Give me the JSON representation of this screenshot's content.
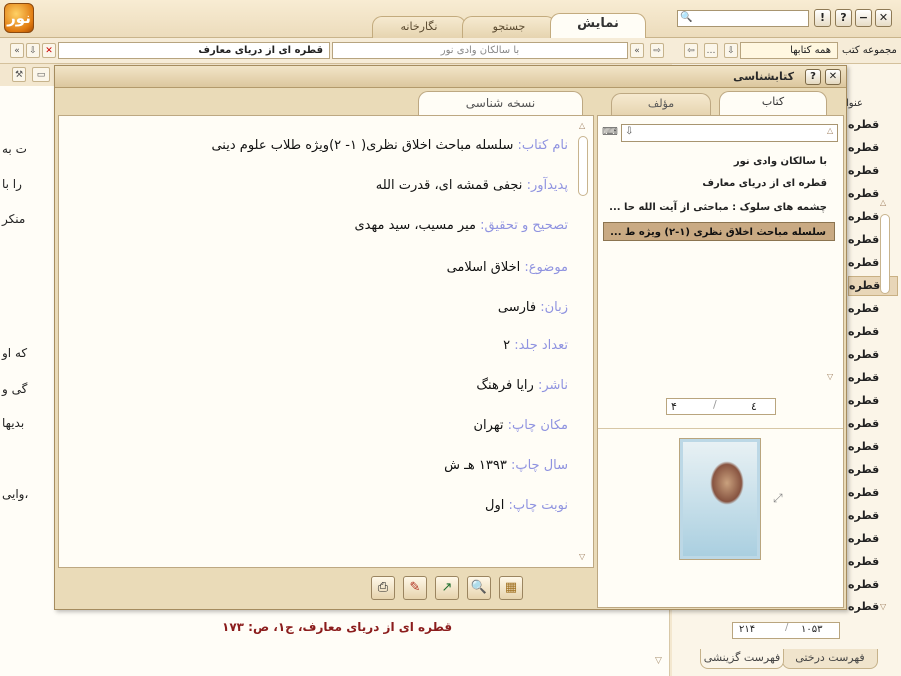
{
  "app": {
    "logo": "نور",
    "main_tabs": [
      "نمایش",
      "جستجو",
      "نگارخانه"
    ],
    "window_buttons": [
      "✕",
      "−",
      "?",
      "!"
    ]
  },
  "toolbar": {
    "current_doc": "قطره ای از دریای معارف",
    "doc_field": "با سالکان وادی نور",
    "collection_label": "مجموعه کتب",
    "collection_value": "همه کتابها"
  },
  "doc": {
    "lines": [
      "ت به",
      "را با",
      "منکر",
      "که او",
      "گی و",
      "بدیها",
      "وایی،"
    ],
    "footer": "قطره ای از دریای معارف، ج۱، ص: ۱۷۳"
  },
  "right_panel": {
    "header": "عنوا",
    "items": [
      "قطره",
      "قطره",
      "قطره",
      "قطره",
      "قطره",
      "قطره",
      "قطره",
      "قطره",
      "قطره",
      "قطره",
      "قطره",
      "قطره",
      "قطره",
      "قطره",
      "قطره",
      "قطره",
      "قطره",
      "قطره",
      "قطره",
      "قطره",
      "قطره",
      "قطره"
    ],
    "count_total": "۱۰۵۳",
    "count_current": "۲۱۴",
    "tabs": [
      "فهرست درختی",
      "فهرست گزینشی"
    ]
  },
  "dialog": {
    "title": "کتابشناسی",
    "left_tab": "نسخه شناسی",
    "right_tabs": [
      "کتاب",
      "مؤلف"
    ],
    "fields": [
      {
        "label": "نام کتاب:",
        "value": "سلسله مباحث اخلاق نظری( ۱- ۲)ویژه طلاب علوم دینی"
      },
      {
        "label": "پدیدآور:",
        "value": "نجفی قمشه ای، قدرت الله"
      },
      {
        "label": "تصحیح و تحقیق:",
        "value": "میر مسیب، سید مهدی"
      },
      {
        "label": "موضوع:",
        "value": "اخلاق اسلامی"
      },
      {
        "label": "زبان:",
        "value": "فارسی"
      },
      {
        "label": "تعداد جلد:",
        "value": "۲"
      },
      {
        "label": "ناشر:",
        "value": "رایا فرهنگ"
      },
      {
        "label": "مکان چاپ:",
        "value": "تهران"
      },
      {
        "label": "سال چاپ:",
        "value": "۱۳۹۳ هـ ش"
      },
      {
        "label": "نوبت چاپ:",
        "value": "اول"
      }
    ],
    "books": [
      "با سالکان وادی نور",
      "قطره ای از دریای معارف",
      "چشمه های سلوک : مباحثی از آیت الله حا ...",
      "سلسله مباحث اخلاق نظری (۱-۲) ویژه ط ..."
    ],
    "selected_book_index": 3,
    "pager_total": "۴",
    "pager_current": "٤",
    "action_buttons": [
      "book-icon",
      "magnifier-icon",
      "export-icon",
      "edit-icon",
      "print-icon"
    ]
  }
}
